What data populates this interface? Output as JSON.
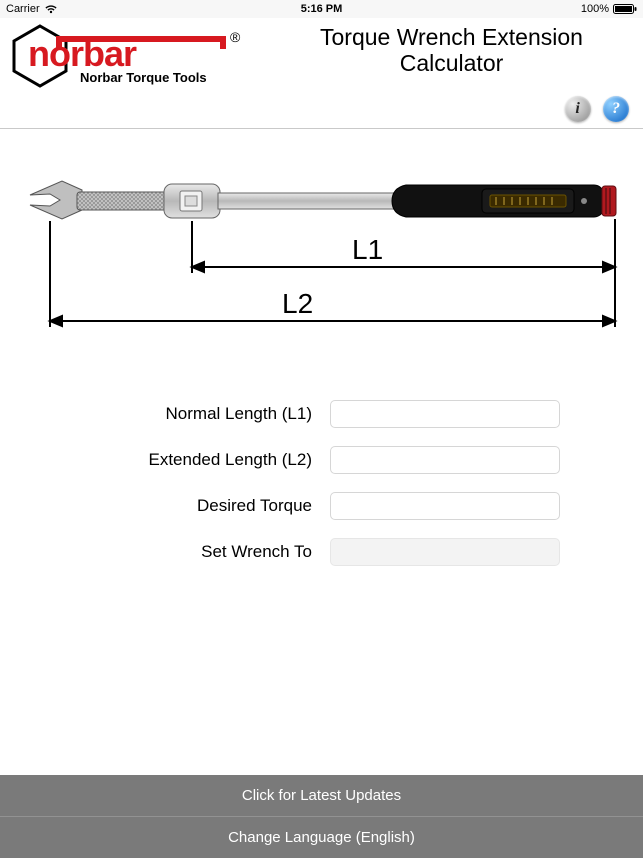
{
  "statusbar": {
    "carrier": "Carrier",
    "time": "5:16 PM",
    "battery_text": "100%"
  },
  "brand": {
    "name": "norbar",
    "tagline": "Norbar Torque Tools",
    "registered_mark": "®"
  },
  "app_title_line1": "Torque Wrench Extension",
  "app_title_line2": "Calculator",
  "icons": {
    "info_glyph": "i",
    "help_glyph": "?"
  },
  "diagram": {
    "label_L1": "L1",
    "label_L2": "L2"
  },
  "form": {
    "normal_length": {
      "label": "Normal Length (L1)",
      "value": ""
    },
    "extended_length": {
      "label": "Extended Length (L2)",
      "value": ""
    },
    "desired_torque": {
      "label": "Desired Torque",
      "value": ""
    },
    "set_wrench_to": {
      "label": "Set Wrench To",
      "value": ""
    }
  },
  "footer": {
    "updates": "Click for Latest Updates",
    "language": "Change Language (English)"
  }
}
